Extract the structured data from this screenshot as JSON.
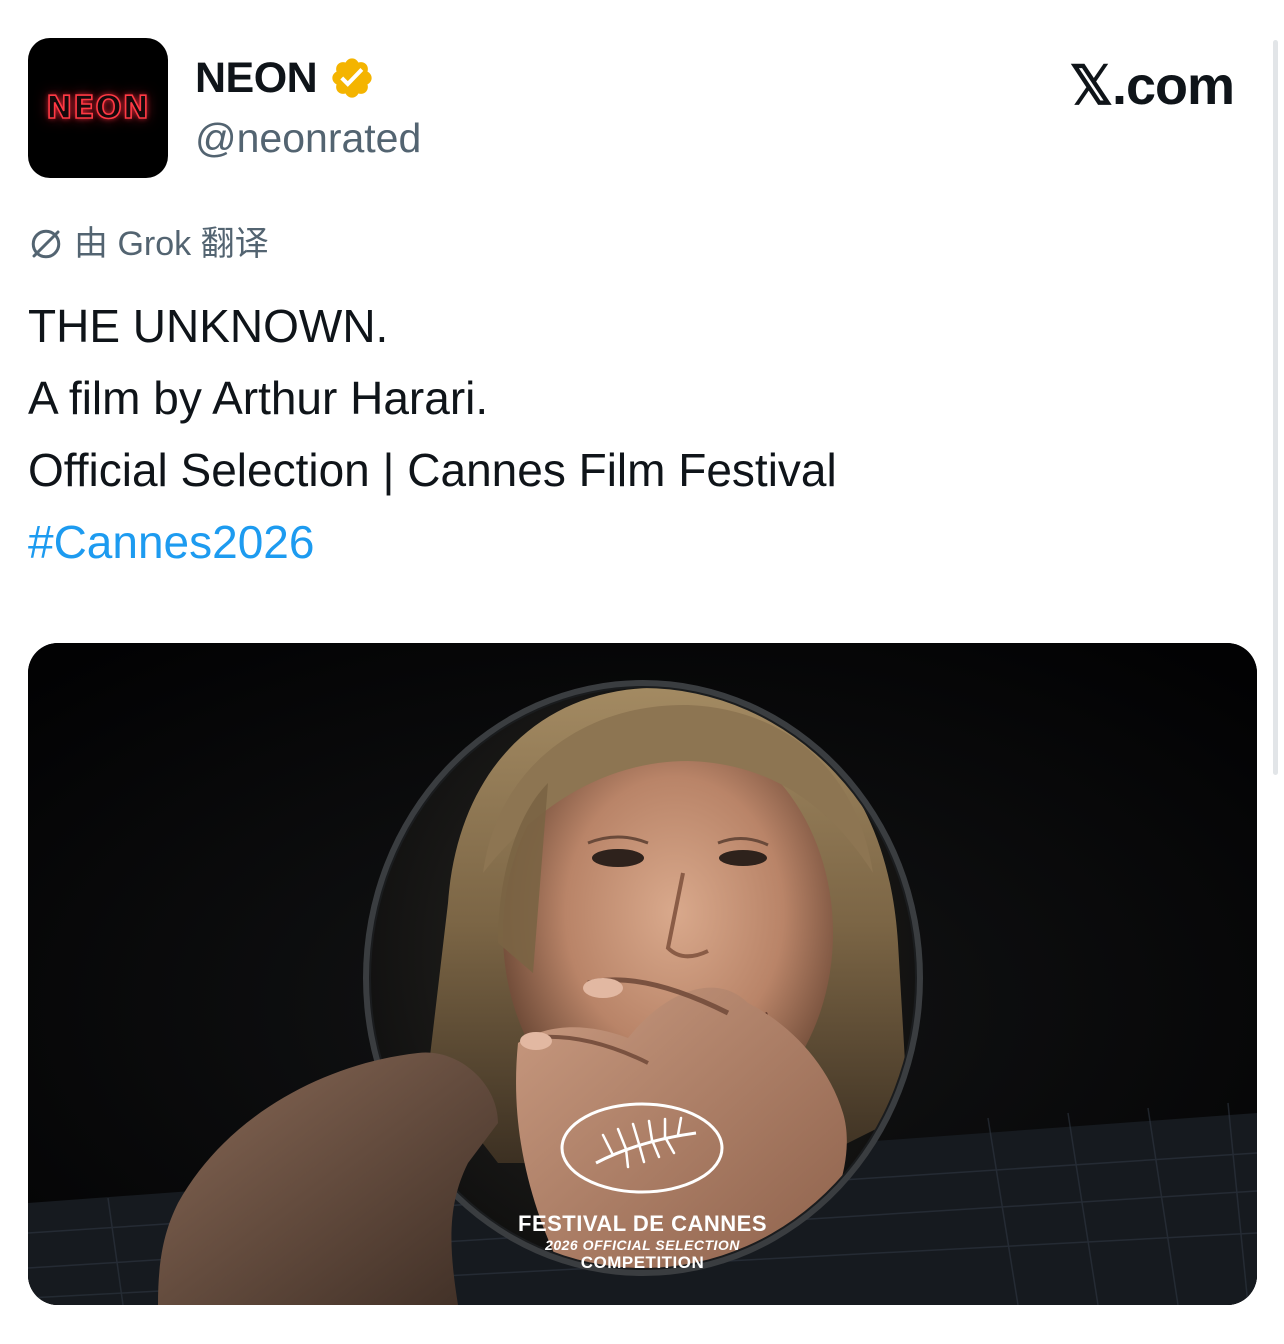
{
  "account": {
    "avatar_text": "NEON",
    "display_name": "NEON",
    "handle": "@neonrated",
    "verified_icon": "verified-badge-icon",
    "verified_color": "#f4b400"
  },
  "site": {
    "label": "𝕏.com"
  },
  "translation": {
    "icon": "globe-icon",
    "label": "由 Grok 翻译"
  },
  "tweet": {
    "lines": [
      "THE UNKNOWN.",
      "A film by Arthur Harari.",
      "Official Selection | Cannes Film Festival"
    ],
    "hashtag": "#Cannes2026",
    "hashtag_color": "#1d9bf0"
  },
  "media": {
    "laurel_icon": "cannes-palm-laurel-icon",
    "festival_title": "FESTIVAL DE CANNES",
    "festival_subtitle": "2026 OFFICIAL SELECTION",
    "festival_section": "COMPETITION"
  }
}
